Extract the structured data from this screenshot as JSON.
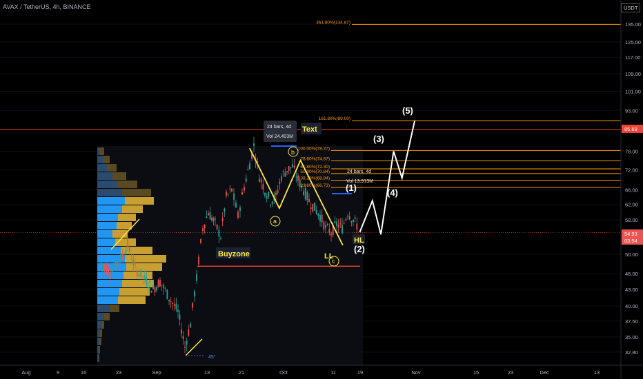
{
  "header": {
    "symbol": "AVAX / TetherUS, 4h, BINANCE",
    "currency": "USDT"
  },
  "price_tags": {
    "level": "85.69",
    "last": "54.93",
    "countdown": "03:54"
  },
  "chart_data": {
    "type": "line",
    "title": "AVAX / TetherUS, 4h, BINANCE",
    "y_scale": "log",
    "ylim": [
      31.3,
      148
    ],
    "y_ticks": [
      "135.00",
      "125.00",
      "117.00",
      "109.00",
      "101.00",
      "93.00",
      "85.69",
      "78.00",
      "72.00",
      "66.00",
      "62.00",
      "58.00",
      "54.93",
      "50.00",
      "46.00",
      "43.00",
      "40.00",
      "37.50",
      "35.00",
      "32.80"
    ],
    "x_ticks": [
      "Aug",
      "9",
      "16",
      "23",
      "Sep",
      "13",
      "21",
      "Oct",
      "11",
      "19",
      "Nov",
      "15",
      "23",
      "Dec",
      "13"
    ],
    "series": [
      {
        "name": "Elliott impulse (1)-(5)",
        "x": [
          "2021-10-19",
          "2021-10-22",
          "2021-10-24",
          "2021-10-27",
          "2021-10-29",
          "2021-11-01"
        ],
        "values": [
          55,
          63,
          54.5,
          78,
          69.5,
          89
        ]
      },
      {
        "name": "ABC correction",
        "x": [
          "2021-09-23",
          "2021-09-30",
          "2021-10-05",
          "2021-10-15"
        ],
        "values": [
          79,
          61,
          75,
          52
        ]
      }
    ],
    "fibonacci": [
      {
        "label": "361.80%(134.87)",
        "value": 134.87
      },
      {
        "label": "161.80%(89.00)",
        "value": 89.0
      },
      {
        "label": "100.00%(78.27)",
        "value": 78.27
      },
      {
        "label": "78.60%(74.87)",
        "value": 74.87
      },
      {
        "label": "61.80%(72.30)",
        "value": 72.3
      },
      {
        "label": "50.00%(70.84)",
        "value": 70.84
      },
      {
        "label": "38.20%(68.84)",
        "value": 68.84
      },
      {
        "label": "23.60%(66.73)",
        "value": 66.73
      }
    ],
    "horizontal_lines": [
      {
        "value": 85.69,
        "color": "#f44336"
      },
      {
        "value": 47.5,
        "color": "#f44336"
      }
    ],
    "annotations": [
      "Text",
      "Buyzone",
      "LL",
      "HL",
      "a",
      "b",
      "c",
      "(1)",
      "(2)",
      "(3)",
      "(4)",
      "(5)",
      "45°"
    ],
    "measure_boxes": [
      {
        "bars": "24 bars, 4d",
        "vol": "Vol 24.403M"
      },
      {
        "bars": "24 bars, 4d",
        "vol": "Vol 13.913M"
      }
    ],
    "colors": {
      "up": "#26a69a",
      "down": "#ef5350",
      "fib": "#ff9800",
      "impulse": "#ffffff",
      "correction": "#ffeb3b",
      "vp_value_area": "#2196f3",
      "vp_up": "#c8a032"
    }
  }
}
